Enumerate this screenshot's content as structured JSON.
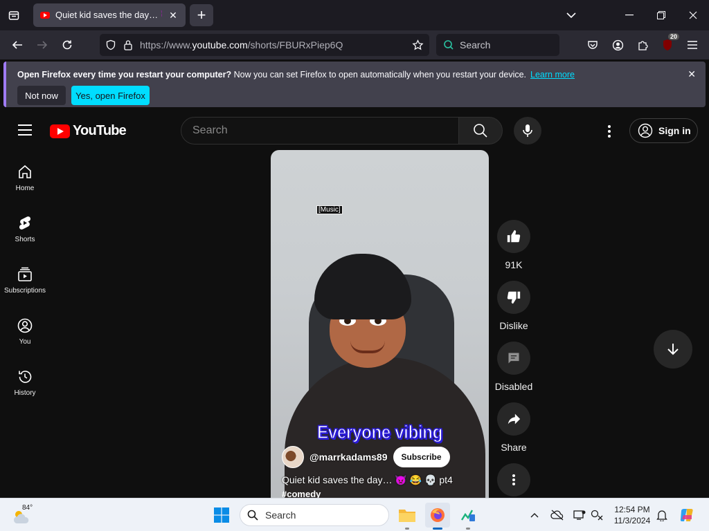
{
  "browser": {
    "tab": {
      "title": "Quiet kid saves the day… 👿 😂"
    },
    "url": {
      "prefix": "https://www.",
      "domain": "youtube.com",
      "path": "/shorts/FBURxPiep6Q"
    },
    "search_placeholder": "Search",
    "extension_badge": "20"
  },
  "notification": {
    "bold_text": "Open Firefox every time you restart your computer?",
    "text": " Now you can set Firefox to open automatically when you restart your device.",
    "link": "Learn more",
    "not_now": "Not now",
    "yes": "Yes, open Firefox"
  },
  "youtube": {
    "logo_text": "YouTube",
    "search_placeholder": "Search",
    "sign_in": "Sign in",
    "sidebar": [
      {
        "label": "Home",
        "icon": "home-icon"
      },
      {
        "label": "Shorts",
        "icon": "shorts-icon"
      },
      {
        "label": "Subscriptions",
        "icon": "subscriptions-icon"
      },
      {
        "label": "You",
        "icon": "you-icon"
      },
      {
        "label": "History",
        "icon": "history-icon"
      }
    ],
    "video": {
      "caption_tag": "[Music]",
      "overlay_text": "Everyone vibing",
      "channel_handle": "@marrkadams89",
      "subscribe": "Subscribe",
      "title": "Quiet kid saves the day… 👿 😂 💀 pt4",
      "hashtag": "#comedy"
    },
    "actions": {
      "like_count": "91K",
      "dislike": "Dislike",
      "comments": "Disabled",
      "share": "Share"
    }
  },
  "taskbar": {
    "weather_temp": "84°",
    "search_placeholder": "Search",
    "time": "12:54 PM",
    "date": "11/3/2024"
  }
}
